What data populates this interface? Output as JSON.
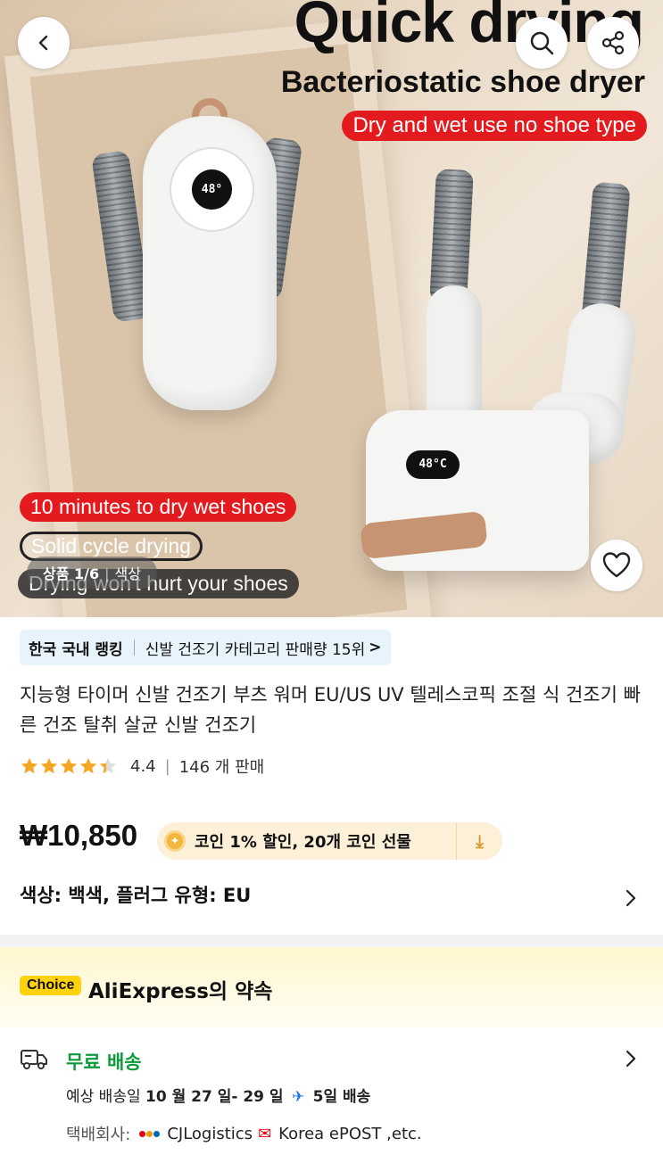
{
  "hero": {
    "headline": "Quick drying",
    "subheadline": "Bacteriostatic shoe dryer",
    "tag_top": "Dry and wet use no shoe type",
    "tag_minutes": "10 minutes to dry wet shoes",
    "tag_cycle": "Solid cycle drying",
    "tag_hurt": "Drying won't hurt your shoes",
    "display_left": "48°",
    "display_right": "48°C",
    "counter_label": "상품 1/6",
    "counter_color_label": "색상"
  },
  "ranking": {
    "label": "한국 국내 랭킹",
    "text": "신발 건조기 카테고리 판매량 15위",
    "chevron": ">"
  },
  "product": {
    "title": "지능형 타이머 신발 건조기 부츠 워머 EU/US UV 텔레스코픽 조절 식 건조기 빠른 건조 탈취 살균 신발 건조기",
    "rating": "4.4",
    "rating_value": 4.4,
    "sold": "146 개 판매",
    "price": "₩10,850",
    "coin_text": "코인 1% 할인,  20개 코인 선물",
    "option_text": "색상: 백색, 플러그 유형: EU"
  },
  "choice": {
    "badge": "Choice",
    "title": "AliExpress의 약속"
  },
  "shipping": {
    "title": "무료 배송",
    "eta_prefix": "예상 배송일",
    "eta_dates": "10 월 27 일- 29 일",
    "eta_days": "5일 배송",
    "carrier_label": "택배회사:",
    "carrier1": "CJLogistics",
    "carrier2": "Korea ePOST ,etc."
  },
  "icons": {
    "back": "back-arrow-icon",
    "search": "search-icon",
    "share": "share-icon",
    "wishlist": "heart-icon",
    "truck": "truck-icon"
  },
  "colors": {
    "accent_red": "#e31b1e",
    "ship_green": "#0c9a3b",
    "star": "#f5a623",
    "choice_yellow": "#ffd20e"
  }
}
